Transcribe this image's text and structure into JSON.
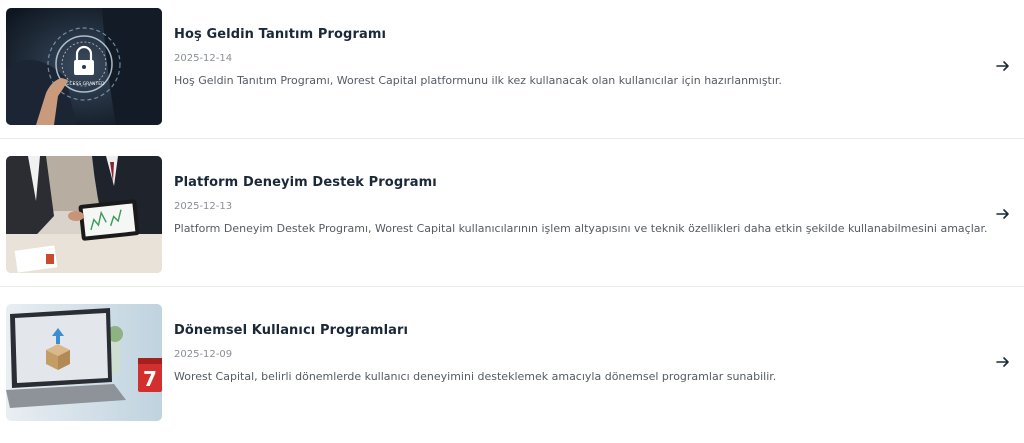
{
  "programs": [
    {
      "title": "Hoş Geldin Tanıtım Programı",
      "date": "2025-12-14",
      "description": "Hoş Geldin Tanıtım Programı, Worest Capital platformunu ilk kez kullanacak olan kullanıcılar için hazırlanmıştır.",
      "image_text": "ACCESS GRANTED",
      "image_icon": "padlock-icon"
    },
    {
      "title": "Platform Deneyim Destek Programı",
      "date": "2025-12-13",
      "description": "Platform Deneyim Destek Programı, Worest Capital kullanıcılarının işlem altyapısını ve teknik özellikleri daha etkin şekilde kullanabilmesini amaçlar.",
      "image_icon": "tablet-chart-icon"
    },
    {
      "title": "Dönemsel Kullanıcı Programları",
      "date": "2025-12-09",
      "description": "Worest Capital, belirli dönemlerde kullanıcı deneyimini desteklemek amacıyla dönemsel programlar sunabilir.",
      "image_text": "7",
      "image_icon": "laptop-box-icon"
    }
  ],
  "arrow_icon": "arrow-right-icon"
}
